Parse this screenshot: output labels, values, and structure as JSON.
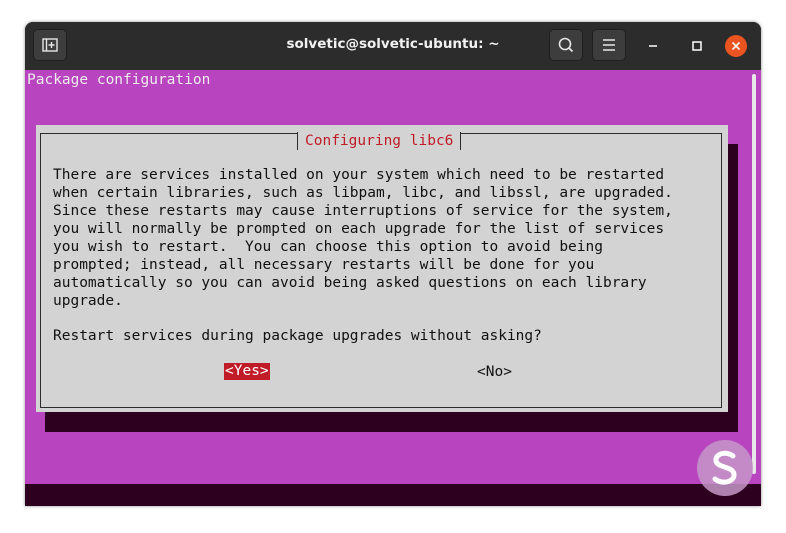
{
  "window": {
    "title": "solvetic@solvetic-ubuntu: ~"
  },
  "titlebar_icons": {
    "new_tab": "new-tab-icon",
    "search": "search-icon",
    "menu": "hamburger-menu-icon",
    "minimize": "minimize-icon",
    "maximize": "maximize-icon",
    "close": "close-icon"
  },
  "terminal": {
    "header": "Package configuration"
  },
  "dialog": {
    "title": "Configuring libc6",
    "message": "There are services installed on your system which need to be restarted\nwhen certain libraries, such as libpam, libc, and libssl, are upgraded.\nSince these restarts may cause interruptions of service for the system,\nyou will normally be prompted on each upgrade for the list of services\nyou wish to restart.  You can choose this option to avoid being\nprompted; instead, all necessary restarts will be done for you\nautomatically so you can avoid being asked questions on each library\nupgrade.",
    "question": "Restart services during package upgrades without asking?",
    "yes_label": "<Yes>",
    "no_label": "<No>"
  },
  "colors": {
    "terminal_bg": "#b844bf",
    "dialog_bg": "#d3d3d3",
    "dialog_title": "#c01c28",
    "selected_button": "#c01c28",
    "close_button": "#e95420",
    "titlebar": "#2c2c2c"
  },
  "watermark": {
    "icon": "solvetic-logo-icon"
  }
}
